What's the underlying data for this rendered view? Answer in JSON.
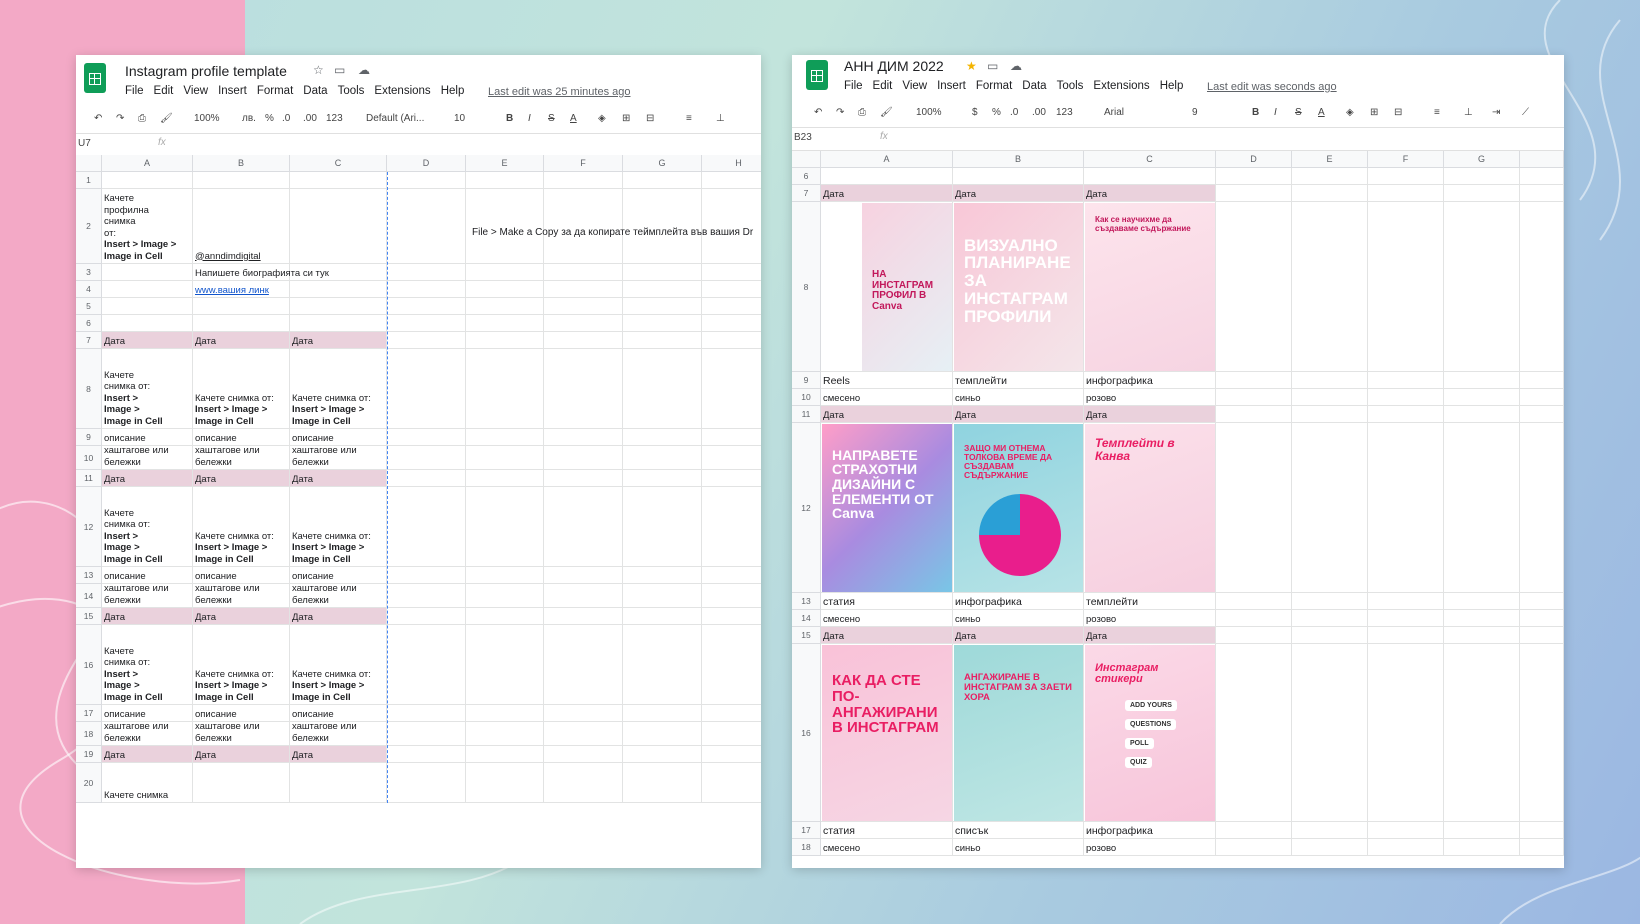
{
  "left": {
    "title": "Instagram profile template",
    "menu": [
      "File",
      "Edit",
      "View",
      "Insert",
      "Format",
      "Data",
      "Tools",
      "Extensions",
      "Help"
    ],
    "last_edit": "Last edit was 25 minutes ago",
    "toolbar": {
      "zoom": "100%",
      "currency": "лв.",
      "percent": "%",
      "dec_less": ".0",
      "dec_more": ".00",
      "format": "123",
      "font": "Default (Ari...",
      "size": "10"
    },
    "cell_ref": "U7",
    "fx": "fx",
    "columns": [
      "A",
      "B",
      "C",
      "D",
      "E",
      "F",
      "G",
      "H"
    ],
    "rows": [
      "1",
      "2",
      "3",
      "4",
      "5",
      "6",
      "7",
      "8",
      "9",
      "10",
      "11",
      "12",
      "13",
      "14",
      "15",
      "16",
      "17",
      "18",
      "19",
      "20"
    ],
    "cells": {
      "a2_line1": "Качете",
      "a2_line2": "профилна",
      "a2_line3": "снимка",
      "a2_line4": "от:",
      "a2_bold": "Insert > Image > Image in Cell",
      "b2": "@anndimdigital",
      "b3": "Напишете биографията си тук",
      "b4": "www.вашия линк",
      "date": "Дата",
      "upload_narrow": "Качете снимка от:",
      "upload_wide": "Качете снимка от:",
      "upload_bold": "Insert > Image > Image in Cell",
      "desc": "описание",
      "tags": "хаштагове или бележки",
      "a20": "Качете снимка"
    },
    "note": "File > Make a Copy за да копирате теймплейта във вашия Dr"
  },
  "right": {
    "title": "АНН ДИМ 2022",
    "menu": [
      "File",
      "Edit",
      "View",
      "Insert",
      "Format",
      "Data",
      "Tools",
      "Extensions",
      "Help"
    ],
    "last_edit": "Last edit was seconds ago",
    "toolbar": {
      "zoom": "100%",
      "currency": "$",
      "percent": "%",
      "dec_less": ".0",
      "dec_more": ".00",
      "format": "123",
      "font": "Arial",
      "size": "9"
    },
    "cell_ref": "B23",
    "fx": "fx",
    "columns": [
      "A",
      "B",
      "C",
      "D",
      "E",
      "F",
      "G"
    ],
    "rows": [
      "6",
      "7",
      "8",
      "9",
      "10",
      "11",
      "12",
      "13",
      "14",
      "15",
      "16",
      "17",
      "18"
    ],
    "date": "Дата",
    "row9": [
      "Reels",
      "темплейти",
      "инфографика"
    ],
    "row10": [
      "смесено",
      "синьо",
      "розово"
    ],
    "row13": [
      "статия",
      "инфографика",
      "темплейти"
    ],
    "row14": [
      "смесено",
      "синьо",
      "розово"
    ],
    "row17": [
      "статия",
      "списък",
      "инфографика"
    ],
    "row18": [
      "смесено",
      "синьо",
      "розово"
    ],
    "images": {
      "r8a": "НА ИНСТАГРАМ ПРОФИЛ В Canva",
      "r8b": "ВИЗУАЛНО ПЛАНИРАНЕ ЗА ИНСТАГРАМ ПРОФИЛИ",
      "r8c": "Как се научихме да създаваме съдържание",
      "r12a": "НАПРАВЕТЕ СТРАХОТНИ ДИЗАЙНИ С ЕЛЕМЕНТИ ОТ Canva",
      "r12b": "ЗАЩО МИ ОТНЕМА ТОЛКОВА ВРЕМЕ ДА СЪЗДАВАМ СЪДЪРЖАНИЕ",
      "r12c": "Темплейти в Канва",
      "r16a": "КАК ДА СТЕ ПО-АНГАЖИРАНИ В ИНСТАГРАМ",
      "r16b": "АНГАЖИРАНЕ В ИНСТАГРАМ ЗА ЗАЕТИ ХОРА",
      "r16c": "Инстаграм стикери",
      "r16c_items": [
        "ADD YOURS",
        "QUESTIONS",
        "POLL",
        "QUIZ"
      ]
    }
  },
  "colors": {
    "pink_bg": "#f3a9c6",
    "date_row": "#ead1dc",
    "sheets_green": "#0f9d58",
    "star": "#f4b400"
  }
}
